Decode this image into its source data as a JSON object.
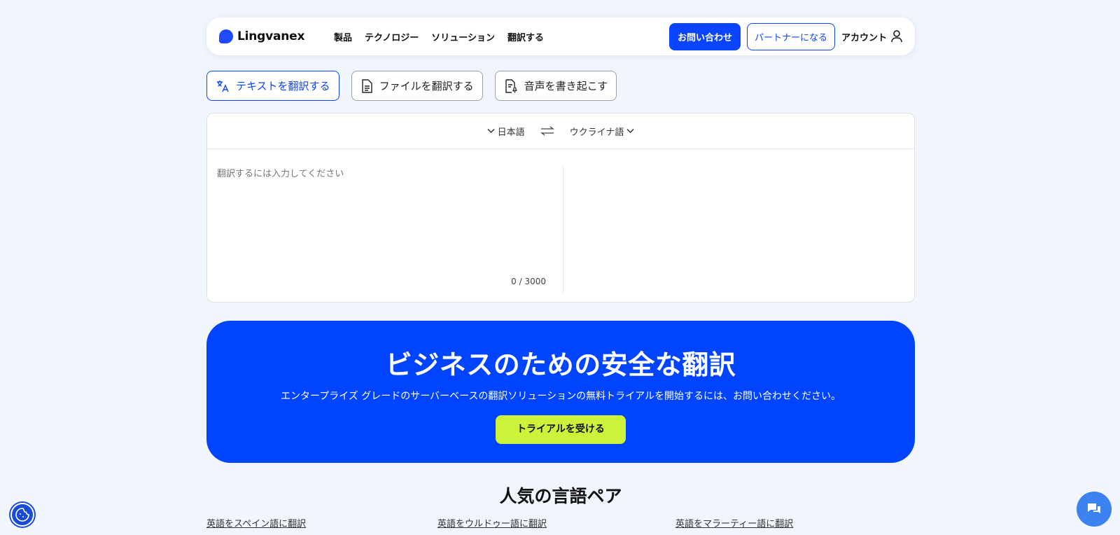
{
  "header": {
    "logo_text": "Lingvanex",
    "nav": [
      "製品",
      "テクノロジー",
      "ソリューション",
      "翻訳する"
    ],
    "contact_label": "お問い合わせ",
    "partner_label": "パートナーになる",
    "account_label": "アカウント"
  },
  "tabs": [
    {
      "label": "テキストを翻訳する",
      "icon": "translate-icon",
      "active": true
    },
    {
      "label": "ファイルを翻訳する",
      "icon": "document-icon",
      "active": false
    },
    {
      "label": "音声を書き起こす",
      "icon": "transcribe-icon",
      "active": false
    }
  ],
  "translator": {
    "source_lang": "日本語",
    "target_lang": "ウクライナ語",
    "placeholder": "翻訳するには入力してください",
    "counter": "0 / 3000"
  },
  "banner": {
    "title": "ビジネスのための安全な翻訳",
    "subtitle": "エンタープライズ グレードのサーバーベースの翻訳ソリューションの無料トライアルを開始するには、お問い合わせください。",
    "cta_label": "トライアルを受ける"
  },
  "popular": {
    "title": "人気の言語ペア",
    "links": [
      "英語をスペイン語に翻訳",
      "英語をウルドゥー語に翻訳",
      "英語をマラーティー語に翻訳"
    ]
  },
  "colors": {
    "brand": "#0a44ff",
    "banner_bg": "#0044ff",
    "cta": "#cdf23a",
    "page_bg": "#f1f5fd"
  }
}
